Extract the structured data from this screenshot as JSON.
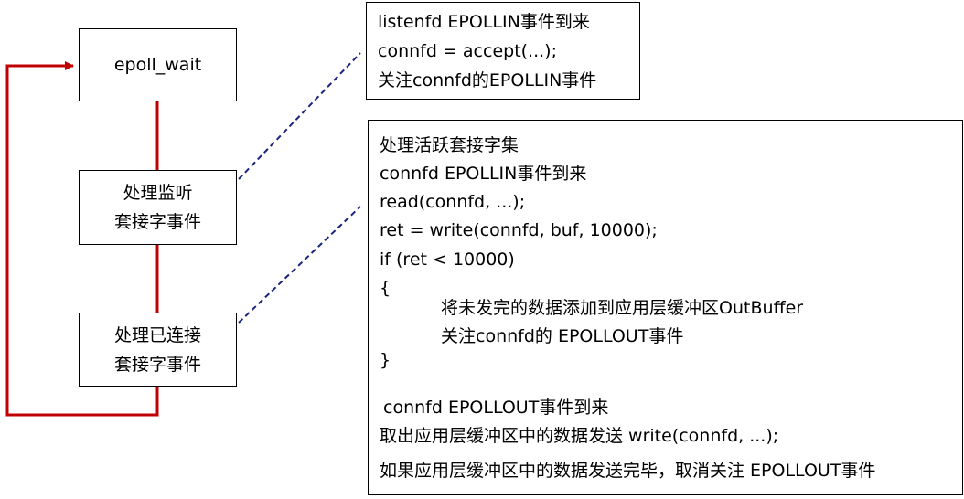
{
  "colors": {
    "loop_line": "#c00000",
    "dashed_connector": "#1a237e",
    "box_border": "#000000",
    "text": "#000000"
  },
  "nodes": {
    "epoll_wait": {
      "label": "epoll_wait"
    },
    "listen": {
      "line1": "处理监听",
      "line2": "套接字事件"
    },
    "connected": {
      "line1": "处理已连接",
      "line2": "套接字事件"
    }
  },
  "listen_note": {
    "lines": [
      "listenfd EPOLLIN事件到来",
      "connfd = accept(...);",
      "关注connfd的EPOLLIN事件"
    ]
  },
  "active_note": {
    "lines": [
      "处理活跃套接字集",
      "connfd  EPOLLIN事件到来",
      "read(connfd, ...);",
      "ret = write(connfd, buf, 10000);",
      "if (ret < 10000)",
      "{",
      "将未发完的数据添加到应用层缓冲区OutBuffer",
      "关注connfd的  EPOLLOUT事件",
      "}",
      "connfd  EPOLLOUT事件到来",
      "取出应用层缓冲区中的数据发送  write(connfd, ...);",
      "如果应用层缓冲区中的数据发送完毕，取消关注 EPOLLOUT事件"
    ]
  }
}
